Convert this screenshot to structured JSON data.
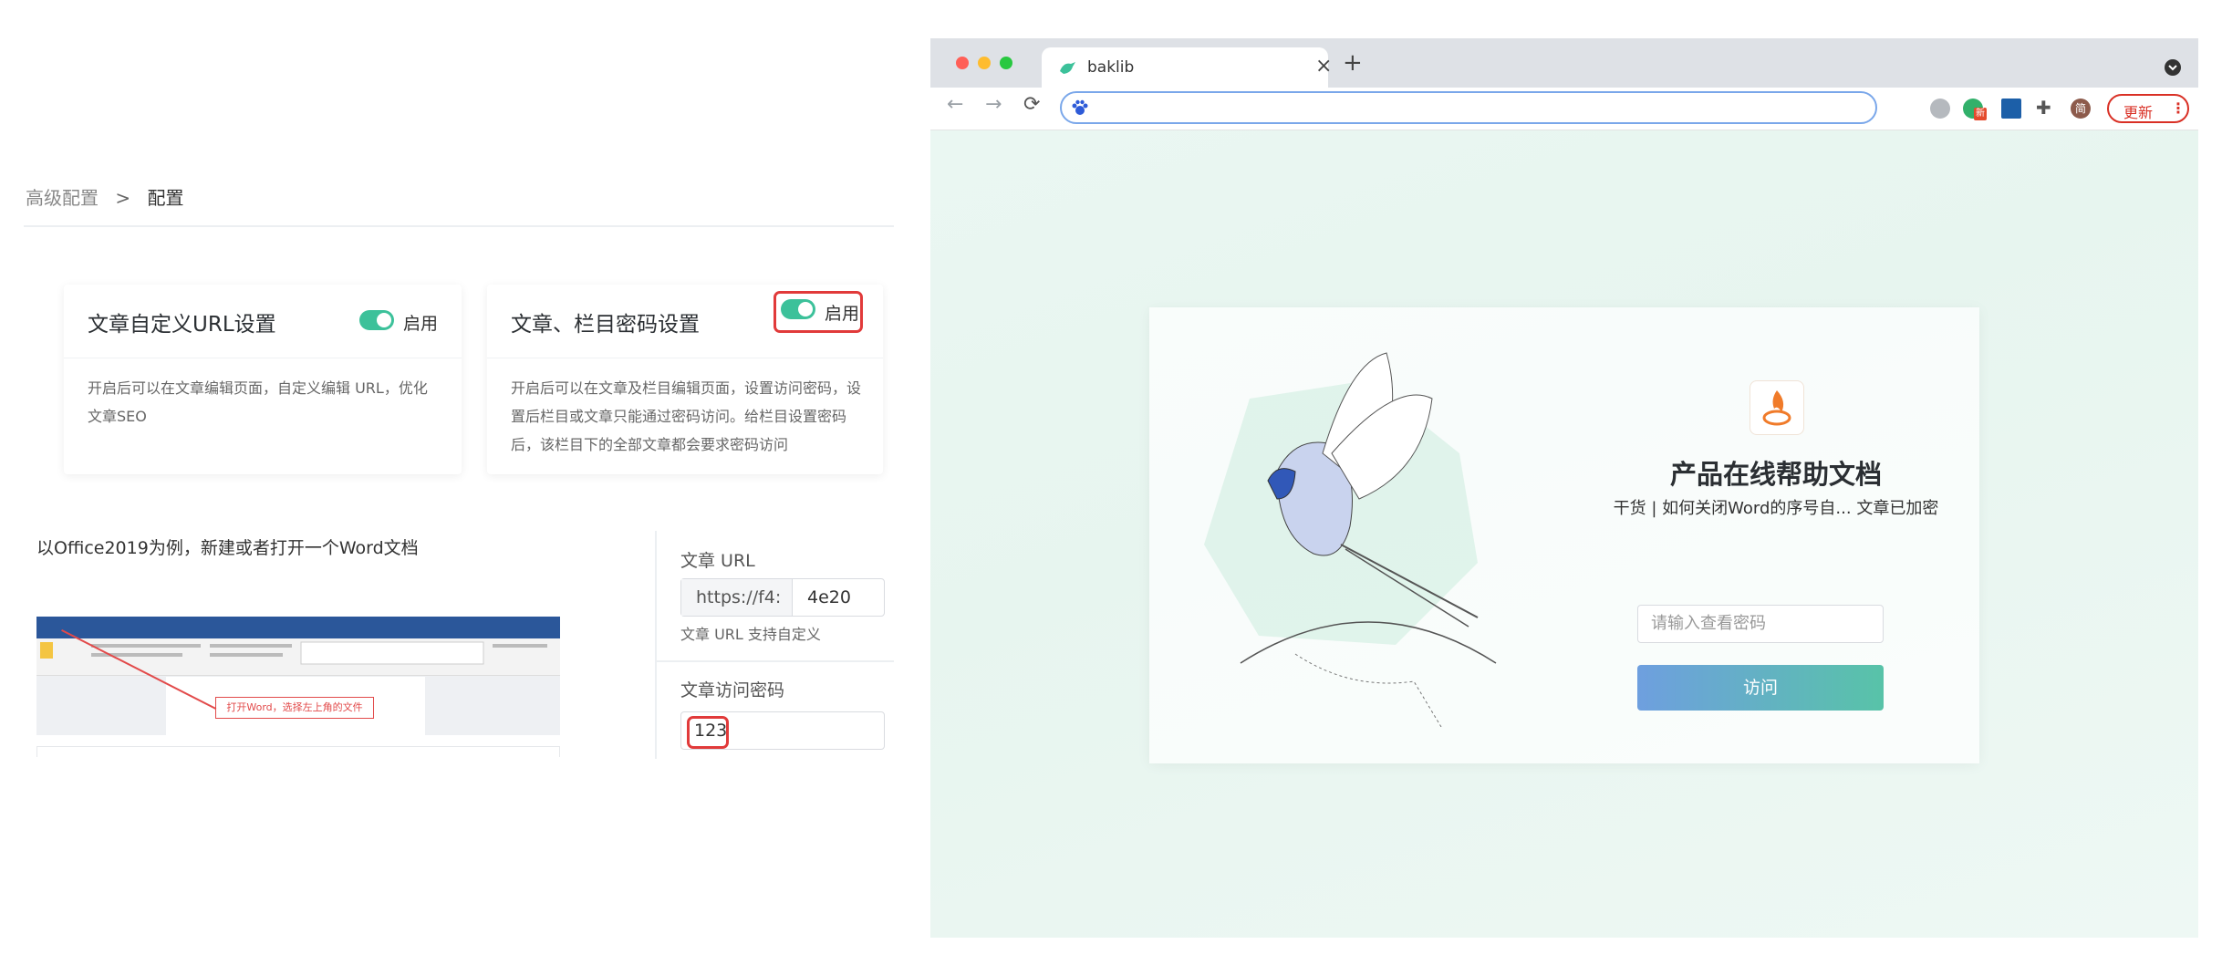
{
  "breadcrumb": {
    "parent": "高级配置",
    "separator": ">",
    "current": "配置"
  },
  "cards": [
    {
      "title": "文章自定义URL设置",
      "toggle_label": "启用",
      "enabled": true,
      "description_lines": [
        "开启后可以在文章编辑页面，自定义编辑 URL，优化",
        "文章SEO"
      ]
    },
    {
      "title": "文章、栏目密码设置",
      "toggle_label": "启用",
      "enabled": true,
      "description_lines": [
        "开启后可以在文章及栏目编辑页面，设置访问密码，设",
        "置后栏目或文章只能通过密码访问。给栏目设置密码",
        "后，该栏目下的全部文章都会要求密码访问"
      ]
    }
  ],
  "left_description": "以Office2019为例，新建或者打开一个Word文档",
  "word_annotation": "打开Word，选择左上角的文件",
  "article_url": {
    "label": "文章 URL",
    "prefix": "https://f4:",
    "value": "4e20",
    "hint": "文章 URL 支持自定义"
  },
  "article_password": {
    "label": "文章访问密码",
    "value": "123"
  },
  "browser": {
    "tab_title": "baklib",
    "new_tab_icon": "+",
    "close_icon": "×",
    "update_label": "更新",
    "menu_icon": "⋮",
    "avatar_text": "简",
    "extension_badge": "新"
  },
  "lock_page": {
    "title": "产品在线帮助文档",
    "subtitle": "干货 | 如何关闭Word的序号自... 文章已加密",
    "password_placeholder": "请输入查看密码",
    "visit_label": "访问"
  },
  "colors": {
    "accent_green": "#3cc19a",
    "highlight_red": "#e13a3a",
    "visit_gradient_start": "#6e9fdf",
    "visit_gradient_end": "#58c3a8",
    "update_red": "#d93025"
  }
}
